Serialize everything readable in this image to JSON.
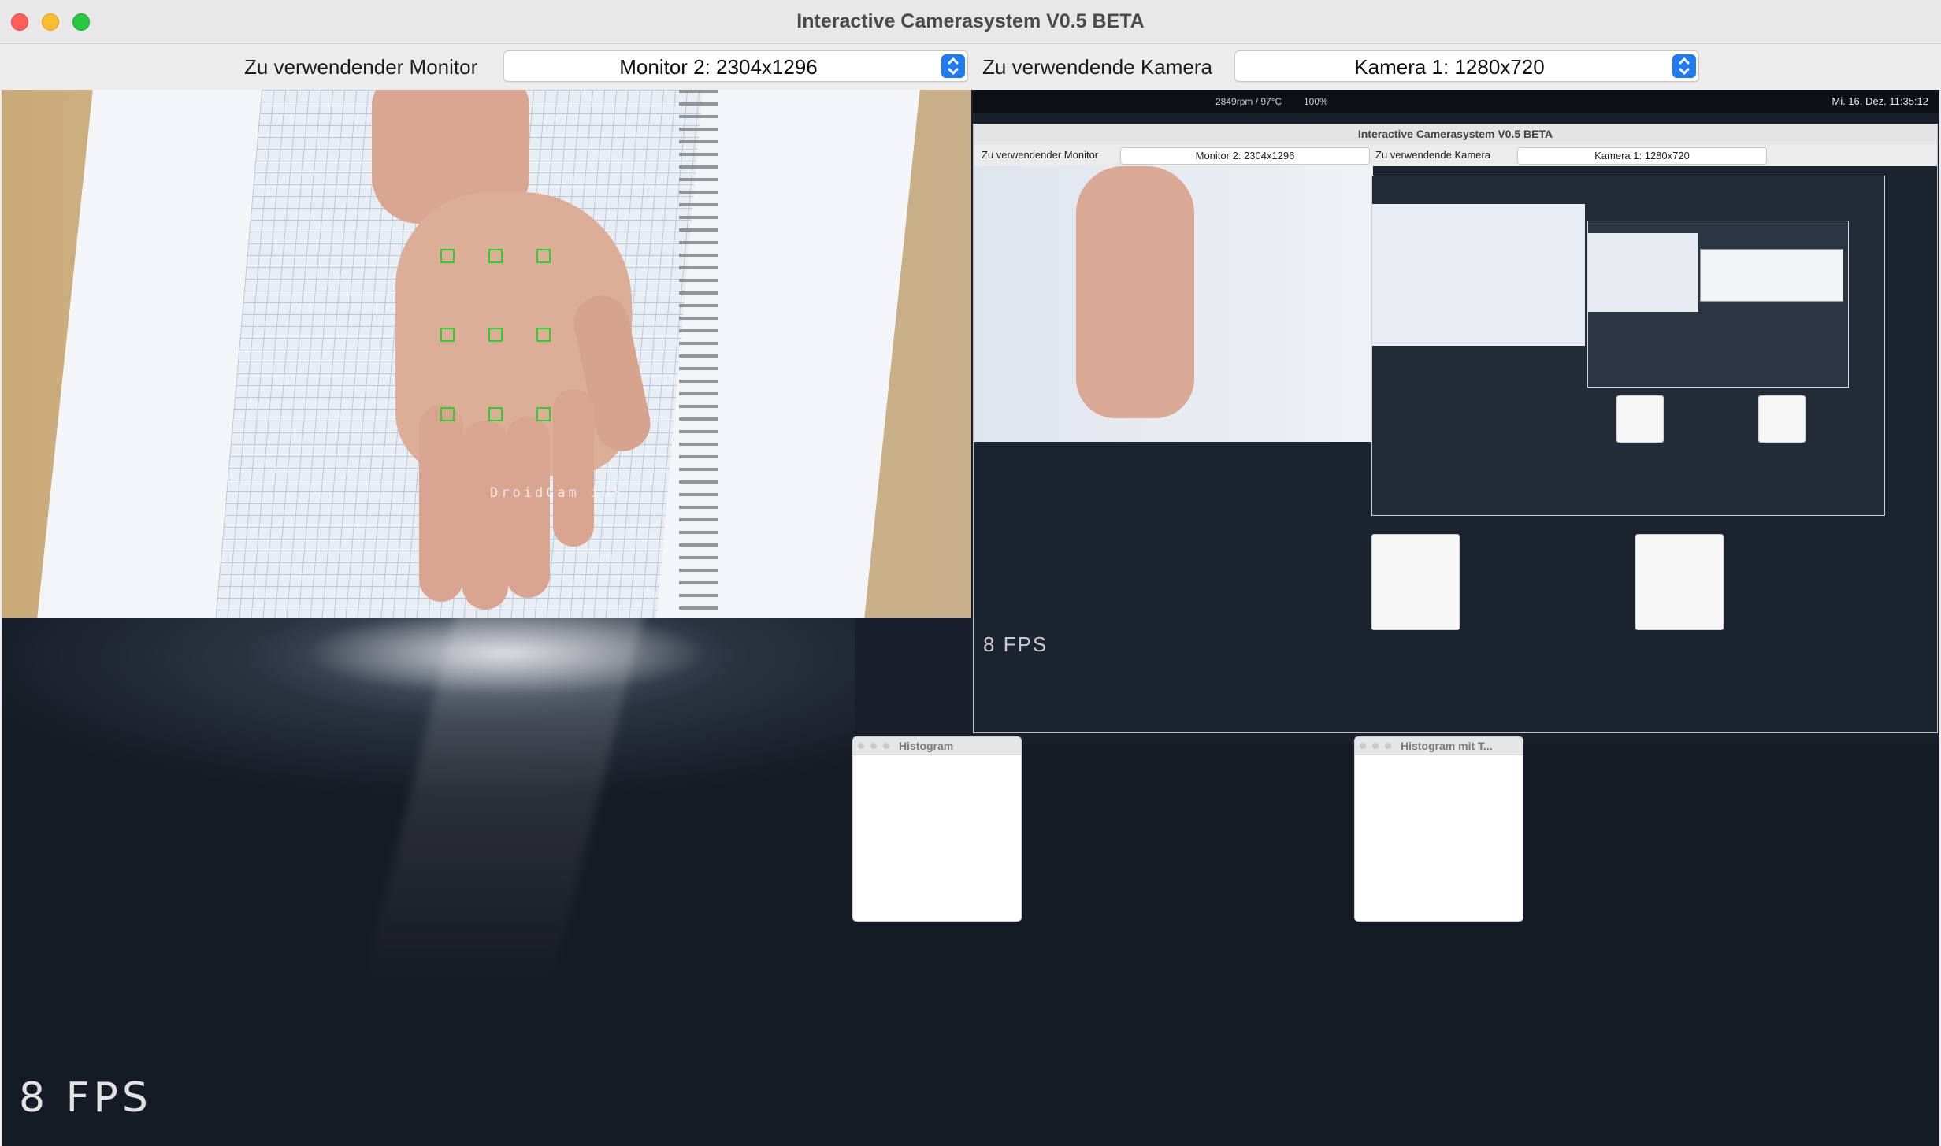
{
  "window": {
    "title": "Interactive Camerasystem V0.5 BETA"
  },
  "toolbar": {
    "monitor_label": "Zu verwendender Monitor",
    "monitor_value": "Monitor 2: 2304x1296",
    "camera_label": "Zu verwendende Kamera",
    "camera_value": "Kamera 1: 1280x720"
  },
  "camera_feed": {
    "watermark": "DroidCam iOS",
    "marker_color": "#28d22c"
  },
  "recursive": {
    "menubar_text": "Mi. 16. Dez. 11:35:12",
    "menubar_stats": "2849rpm / 97°C",
    "battery": "100%",
    "window_title": "Interactive Camerasystem V0.5 BETA",
    "monitor_label": "Zu verwendender Monitor",
    "monitor_value": "Monitor 2: 2304x1296",
    "camera_label": "Zu verwendende Kamera",
    "camera_value": "Kamera 1: 1280x720",
    "fps": "8 FPS"
  },
  "histograms": [
    {
      "title": "Histogram"
    },
    {
      "title": "Histogram mit T..."
    }
  ],
  "status": {
    "fps": "8 FPS"
  },
  "colors": {
    "accent": "#1f7bf2",
    "close": "#ff5f57",
    "minimize": "#febc2e",
    "maximize": "#28c840"
  }
}
